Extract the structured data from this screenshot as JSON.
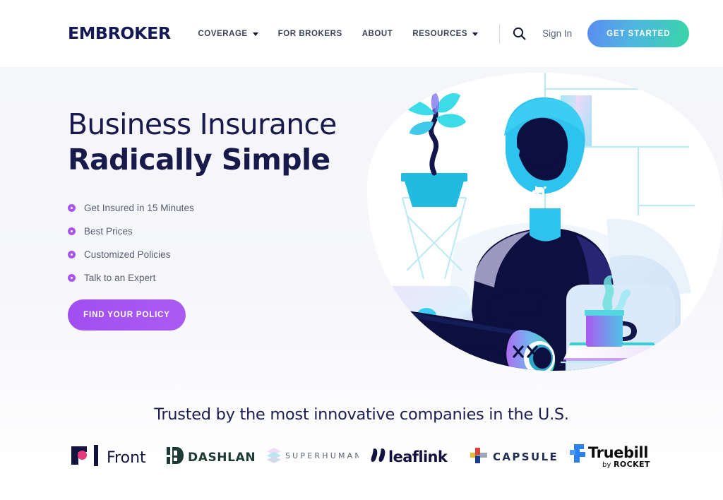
{
  "header": {
    "logo": "EMBROKER",
    "nav": [
      {
        "label": "COVERAGE",
        "has_caret": true
      },
      {
        "label": "FOR BROKERS",
        "has_caret": false
      },
      {
        "label": "ABOUT",
        "has_caret": false
      },
      {
        "label": "RESOURCES",
        "has_caret": true
      }
    ],
    "search_icon": "search-icon",
    "signin_label": "Sign In",
    "cta_label": "GET STARTED",
    "cta_gradient_from": "#5b8cf0",
    "cta_gradient_to": "#37d6a6"
  },
  "hero": {
    "headline_line1": "Business Insurance",
    "headline_line2": "Radically Simple",
    "bullets": [
      "Get Insured in 15 Minutes",
      "Best Prices",
      "Customized Policies",
      "Talk to an Expert"
    ],
    "bullet_color": "#a855e8",
    "cta_label": "FIND YOUR POLICY",
    "cta_color": "#a44ff0",
    "illustration": "person-at-desk-with-laptop-illustration",
    "background_color": "#f5f6fa"
  },
  "trusted": {
    "title": "Trusted by the most innovative companies in the U.S.",
    "logos": [
      {
        "name": "Front",
        "icon": "front-logo"
      },
      {
        "name": "DASHLANE",
        "icon": "dashlane-logo"
      },
      {
        "name": "SUPERHUMAN",
        "icon": "superhuman-logo"
      },
      {
        "name": "leaflink",
        "icon": "leaflink-logo"
      },
      {
        "name": "CAPSULE",
        "icon": "capsule-logo"
      },
      {
        "name": "Truebill",
        "sub": "by ROCKET",
        "icon": "truebill-logo"
      }
    ]
  }
}
